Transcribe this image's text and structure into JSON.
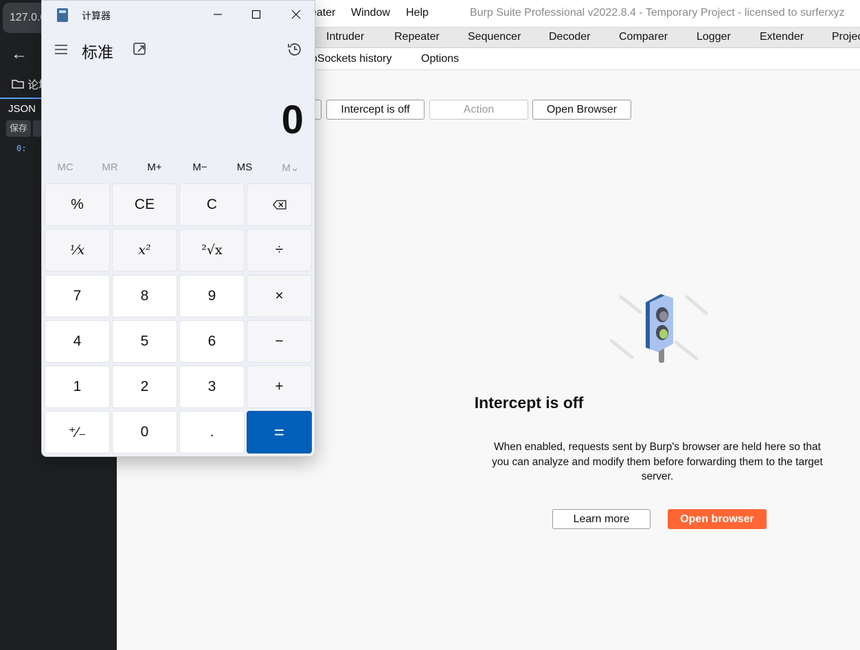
{
  "browser": {
    "url": "127.0.0.1",
    "folder_label": "论坛",
    "json_tab": "JSON",
    "save_button": "保存",
    "json_line": "0:"
  },
  "burp": {
    "menus": [
      "eater",
      "Window",
      "Help"
    ],
    "window_title": "Burp Suite Professional v2022.8.4 - Temporary Project - licensed to surferxyz",
    "top_tabs": [
      "Intruder",
      "Repeater",
      "Sequencer",
      "Decoder",
      "Comparer",
      "Logger",
      "Extender",
      "Projec"
    ],
    "sub_tabs": [
      "bSockets history",
      "Options"
    ],
    "buttons": {
      "intercept": "Intercept is off",
      "action": "Action",
      "open_browser": "Open Browser"
    },
    "empty_state": {
      "title": "Intercept is off",
      "description": "When enabled, requests sent by Burp's browser are held here so that you can analyze and modify them before forwarding them to the target server.",
      "learn_more": "Learn more",
      "open_browser": "Open browser"
    },
    "accent_color": "#ff6633"
  },
  "calculator": {
    "title": "计算器",
    "mode": "标准",
    "display": "0",
    "memory": [
      "MC",
      "MR",
      "M+",
      "M−",
      "MS",
      "M⌄"
    ],
    "keys": [
      [
        "%",
        "CE",
        "C",
        "⌫"
      ],
      [
        "⅟x",
        "x²",
        "²√x",
        "÷"
      ],
      [
        "7",
        "8",
        "9",
        "×"
      ],
      [
        "4",
        "5",
        "6",
        "−"
      ],
      [
        "1",
        "2",
        "3",
        "+"
      ],
      [
        "⁺∕₋",
        "0",
        ".",
        "="
      ]
    ],
    "accent_color": "#005fb8"
  }
}
